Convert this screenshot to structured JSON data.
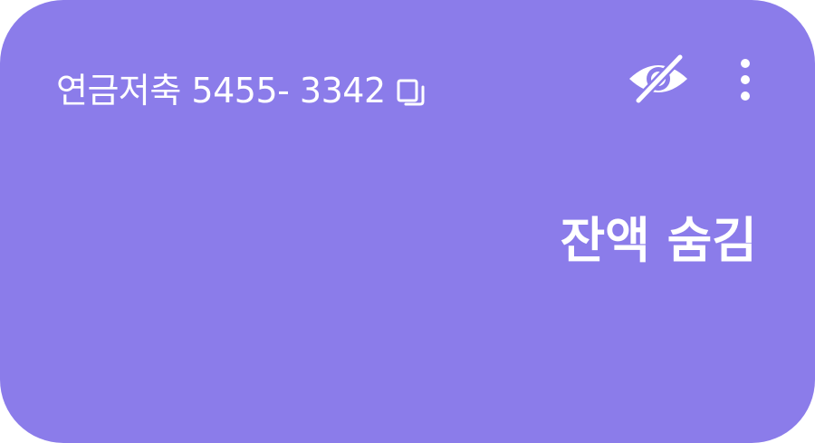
{
  "card": {
    "background_color": "#8b7cea",
    "text_color": "#ffffff",
    "account_label": "연금저축 5455- 3342",
    "copy_icon": "copy-icon",
    "visibility_icon": "eye-off-icon",
    "more_icon": "more-vertical-icon",
    "balance_text": "잔액 숨김"
  }
}
